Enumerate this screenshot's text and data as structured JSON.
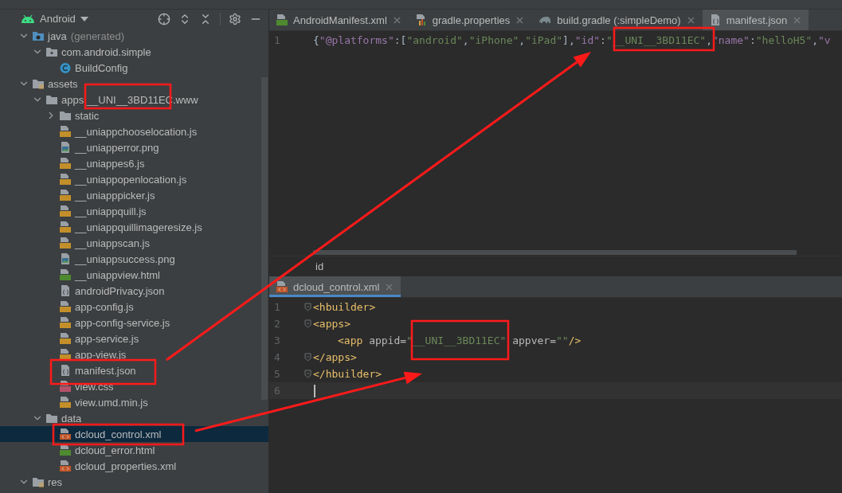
{
  "project_panel": {
    "view": "Android",
    "tree": [
      {
        "label": "java",
        "note": "(generated)",
        "kind": "java-folder",
        "expanded": true,
        "selected": false,
        "children": [
          {
            "label": "com.android.simple",
            "kind": "package",
            "expanded": true,
            "selected": false,
            "children": [
              {
                "label": "BuildConfig",
                "kind": "class",
                "selected": false
              }
            ]
          }
        ]
      },
      {
        "label": "assets",
        "kind": "res-folder",
        "expanded": true,
        "selected": false,
        "children": [
          {
            "label": "apps.__UNI__3BD11EC.www",
            "kind": "folder",
            "expanded": true,
            "selected": false,
            "children": [
              {
                "label": "static",
                "kind": "folder",
                "expanded": false,
                "selected": false
              },
              {
                "label": "__uniappchooselocation.js",
                "kind": "js",
                "selected": false
              },
              {
                "label": "__uniapperror.png",
                "kind": "png",
                "selected": false
              },
              {
                "label": "__uniappes6.js",
                "kind": "js",
                "selected": false
              },
              {
                "label": "__uniappopenlocation.js",
                "kind": "js",
                "selected": false
              },
              {
                "label": "__uniapppicker.js",
                "kind": "js",
                "selected": false
              },
              {
                "label": "__uniappquill.js",
                "kind": "js",
                "selected": false
              },
              {
                "label": "__uniappquillimageresize.js",
                "kind": "js",
                "selected": false
              },
              {
                "label": "__uniappscan.js",
                "kind": "js",
                "selected": false
              },
              {
                "label": "__uniappsuccess.png",
                "kind": "png",
                "selected": false
              },
              {
                "label": "__uniappview.html",
                "kind": "html",
                "selected": false
              },
              {
                "label": "androidPrivacy.json",
                "kind": "json",
                "selected": false
              },
              {
                "label": "app-config.js",
                "kind": "js",
                "selected": false
              },
              {
                "label": "app-config-service.js",
                "kind": "js",
                "selected": false
              },
              {
                "label": "app-service.js",
                "kind": "js",
                "selected": false
              },
              {
                "label": "app-view.js",
                "kind": "js",
                "selected": false
              },
              {
                "label": "manifest.json",
                "kind": "json",
                "selected": false
              },
              {
                "label": "view.css",
                "kind": "css",
                "selected": false
              },
              {
                "label": "view.umd.min.js",
                "kind": "js",
                "selected": false
              }
            ]
          },
          {
            "label": "data",
            "kind": "folder",
            "expanded": true,
            "selected": false,
            "children": [
              {
                "label": "dcloud_control.xml",
                "kind": "xml",
                "selected": true
              },
              {
                "label": "dcloud_error.html",
                "kind": "html",
                "selected": false
              },
              {
                "label": "dcloud_properties.xml",
                "kind": "xml",
                "selected": false
              }
            ]
          }
        ]
      },
      {
        "label": "res",
        "kind": "res-folder",
        "expanded": true,
        "selected": false
      }
    ]
  },
  "top_editor": {
    "tabs": [
      {
        "label": "AndroidManifest.xml",
        "kind": "manifest",
        "selected": false
      },
      {
        "label": "gradle.properties",
        "kind": "properties",
        "selected": false
      },
      {
        "label": "build.gradle (:simpleDemo)",
        "kind": "gradle",
        "selected": false
      },
      {
        "label": "manifest.json",
        "kind": "json",
        "selected": true
      }
    ],
    "lines": [
      {
        "number": "1",
        "fold": false,
        "current": false,
        "tokens": [
          {
            "text": "{",
            "kind": "punct"
          },
          {
            "text": "\"@platforms\"",
            "kind": "key"
          },
          {
            "text": ":[",
            "kind": "punct"
          },
          {
            "text": "\"android\"",
            "kind": "string"
          },
          {
            "text": ",",
            "kind": "punct"
          },
          {
            "text": "\"iPhone\"",
            "kind": "string"
          },
          {
            "text": ",",
            "kind": "punct"
          },
          {
            "text": "\"iPad\"",
            "kind": "string"
          },
          {
            "text": "],",
            "kind": "punct"
          },
          {
            "text": "\"id\"",
            "kind": "key"
          },
          {
            "text": ":",
            "kind": "punct"
          },
          {
            "text": "\"__UNI__3BD11EC\"",
            "kind": "string"
          },
          {
            "text": ",",
            "kind": "punct"
          },
          {
            "text": "\"name\"",
            "kind": "key"
          },
          {
            "text": ":",
            "kind": "punct"
          },
          {
            "text": "\"helloH5\"",
            "kind": "string"
          },
          {
            "text": ",",
            "kind": "punct"
          },
          {
            "text": "\"v",
            "kind": "key"
          }
        ]
      }
    ],
    "breadcrumb": "id"
  },
  "bottom_editor": {
    "tabs": [
      {
        "label": "dcloud_control.xml",
        "kind": "xml",
        "selected": true
      }
    ],
    "lines": [
      {
        "number": "1",
        "fold": true,
        "current": false,
        "tokens": [
          {
            "text": "<hbuilder>",
            "kind": "tag"
          }
        ]
      },
      {
        "number": "2",
        "fold": true,
        "current": false,
        "tokens": [
          {
            "text": "<apps>",
            "kind": "tag"
          }
        ]
      },
      {
        "number": "3",
        "fold": false,
        "current": false,
        "indented": true,
        "tokens": [
          {
            "text": "<app ",
            "kind": "tag"
          },
          {
            "text": "appid=",
            "kind": "attr"
          },
          {
            "text": "\"__UNI__3BD11EC\"",
            "kind": "string"
          },
          {
            "text": " appver=",
            "kind": "attr"
          },
          {
            "text": "\"\"",
            "kind": "string"
          },
          {
            "text": "/>",
            "kind": "tag"
          }
        ]
      },
      {
        "number": "4",
        "fold": true,
        "current": false,
        "tokens": [
          {
            "text": "</apps>",
            "kind": "tag"
          }
        ]
      },
      {
        "number": "5",
        "fold": true,
        "current": false,
        "tokens": [
          {
            "text": "</hbuilder>",
            "kind": "tag"
          }
        ]
      },
      {
        "number": "6",
        "fold": false,
        "current": true
      }
    ]
  }
}
